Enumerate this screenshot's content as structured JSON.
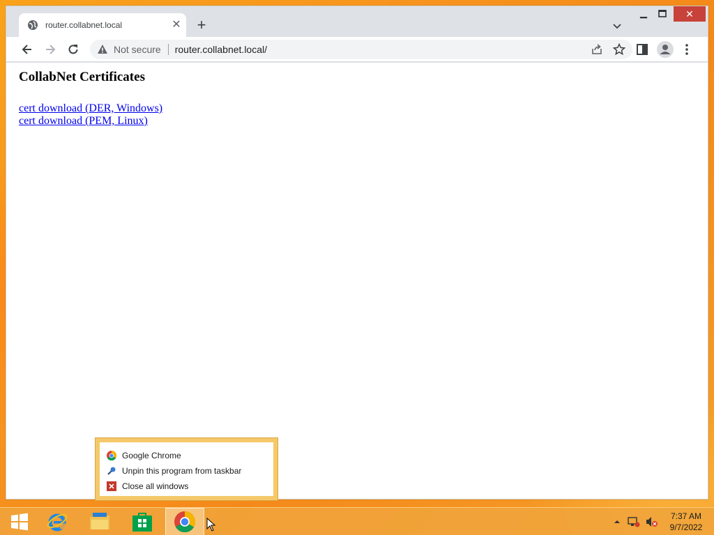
{
  "browser": {
    "tab_title": "router.collabnet.local",
    "address": {
      "security_label": "Not secure",
      "url": "router.collabnet.local/"
    }
  },
  "page": {
    "heading": "CollabNet Certificates",
    "links": [
      {
        "label": "cert download (DER, Windows)"
      },
      {
        "label": "cert download (PEM, Linux)"
      }
    ]
  },
  "jumplist": {
    "items": [
      {
        "label": "Google Chrome",
        "icon": "chrome-icon"
      },
      {
        "label": "Unpin this program from taskbar",
        "icon": "unpin-icon"
      },
      {
        "label": "Close all windows",
        "icon": "close-windows-icon"
      }
    ]
  },
  "taskbar": {
    "pinned": [
      "start-icon",
      "internet-explorer-icon",
      "file-explorer-icon",
      "store-icon",
      "chrome-icon"
    ],
    "clock": {
      "time": "7:37 AM",
      "date": "9/7/2022"
    }
  },
  "colors": {
    "desktop": "#f7931e",
    "chrome_frame": "#dee1e6",
    "link": "#0000ee",
    "close_button": "#c7423a"
  }
}
